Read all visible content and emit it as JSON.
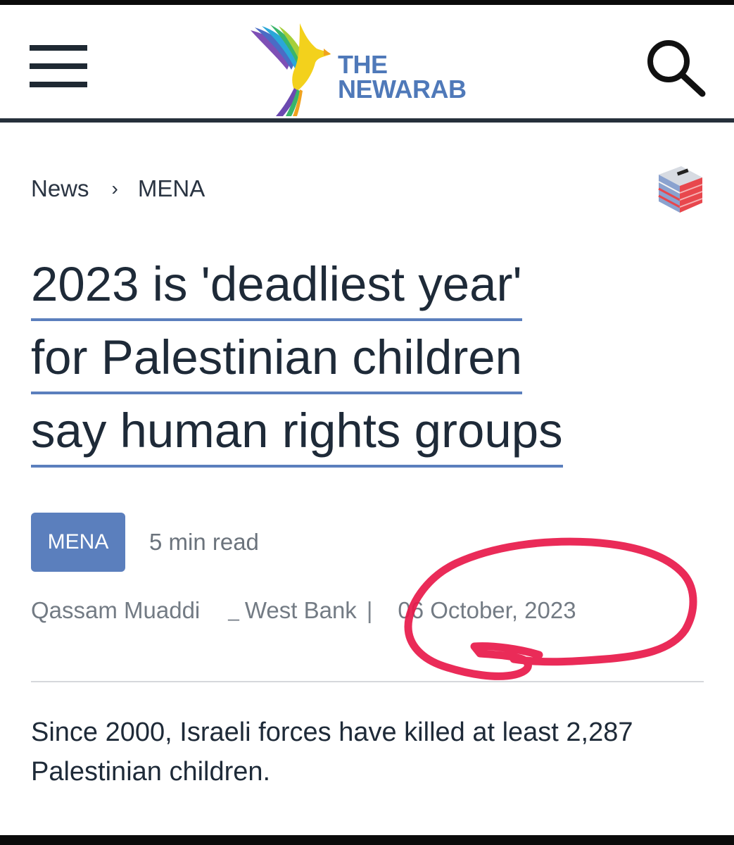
{
  "header": {
    "logo_line1": "THE",
    "logo_line2": "NEWARAB",
    "menu_icon": "hamburger-menu-icon",
    "search_icon": "search-icon",
    "brand_color": "#4f79b9"
  },
  "breadcrumb": {
    "items": [
      "News",
      "MENA"
    ],
    "separator": "›"
  },
  "ballot_icon": "ballot-box-icon",
  "article": {
    "headline_lines": [
      "2023 is 'deadliest year'",
      "for Palestinian children",
      "say human rights groups"
    ],
    "category_badge": "MENA",
    "read_time": "5 min read",
    "author": "Qassam Muaddi",
    "dash": "_",
    "location": "West Bank",
    "pipe": "|",
    "date": "06 October, 2023",
    "summary": "Since 2000, Israeli forces have killed at least 2,287 Palestinian children."
  },
  "colors": {
    "accent": "#5b7fbd",
    "annotation": "#e8194a",
    "text": "#1e2a38",
    "muted": "#737b84"
  }
}
